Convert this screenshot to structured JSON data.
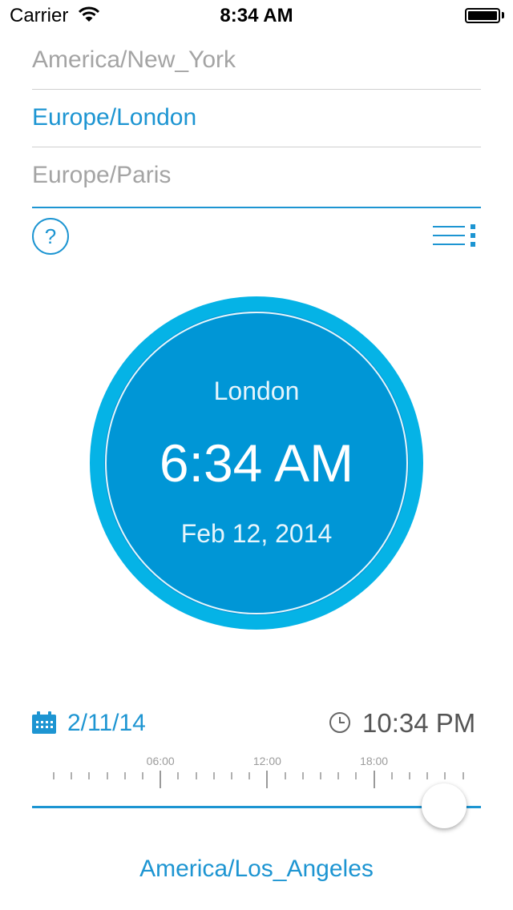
{
  "status_bar": {
    "carrier": "Carrier",
    "time": "8:34 AM",
    "battery_percent": 100
  },
  "timezone_list": [
    {
      "label": "America/New_York",
      "selected": false
    },
    {
      "label": "Europe/London",
      "selected": true
    },
    {
      "label": "Europe/Paris",
      "selected": false
    }
  ],
  "toolbar": {
    "help_label": "?",
    "help_icon": "question-circle-icon",
    "menu_icon": "list-menu-icon"
  },
  "clock_face": {
    "city": "London",
    "time": "6:34 AM",
    "date": "Feb 12, 2014",
    "colors": {
      "outer": "#05b3e6",
      "inner": "#0096d6"
    }
  },
  "controls": {
    "date": "2/11/14",
    "date_icon": "calendar-icon",
    "time": "10:34 PM",
    "time_icon": "clock-icon"
  },
  "slider": {
    "tick_labels": [
      "06:00",
      "12:00",
      "18:00"
    ],
    "value_fraction": 0.918
  },
  "bottom_timezone": "America/Los_Angeles",
  "accent_color": "#1d95d2"
}
